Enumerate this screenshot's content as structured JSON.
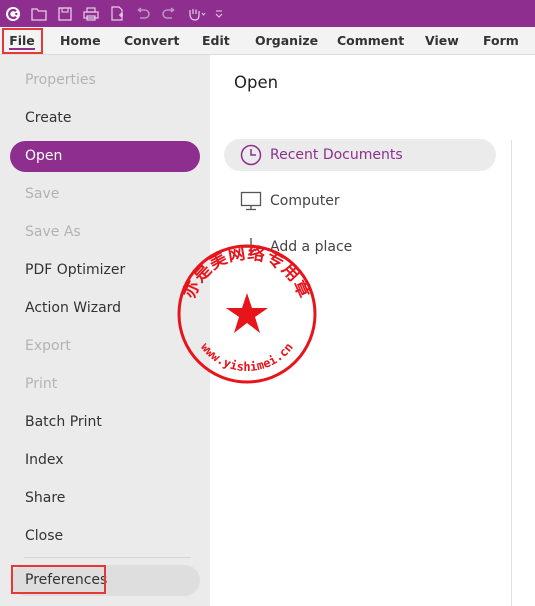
{
  "quick_access": {
    "icons": [
      "app-logo-icon",
      "open-folder-icon",
      "save-icon",
      "print-icon",
      "new-document-icon",
      "undo-icon",
      "redo-icon",
      "hand-tool-icon",
      "customize-dropdown-icon"
    ]
  },
  "tabs": [
    {
      "label": "File"
    },
    {
      "label": "Home"
    },
    {
      "label": "Convert"
    },
    {
      "label": "Edit"
    },
    {
      "label": "Organize"
    },
    {
      "label": "Comment"
    },
    {
      "label": "View"
    },
    {
      "label": "Form"
    }
  ],
  "menu": [
    {
      "label": "Properties",
      "state": "disabled"
    },
    {
      "label": "Create",
      "state": "normal"
    },
    {
      "label": "Open",
      "state": "selected"
    },
    {
      "label": "Save",
      "state": "disabled"
    },
    {
      "label": "Save As",
      "state": "disabled"
    },
    {
      "label": "PDF Optimizer",
      "state": "normal"
    },
    {
      "label": "Action Wizard",
      "state": "normal"
    },
    {
      "label": "Export",
      "state": "disabled"
    },
    {
      "label": "Print",
      "state": "disabled"
    },
    {
      "label": "Batch Print",
      "state": "normal"
    },
    {
      "label": "Index",
      "state": "normal"
    },
    {
      "label": "Share",
      "state": "normal"
    },
    {
      "label": "Close",
      "state": "normal"
    },
    {
      "label": "Preferences",
      "state": "highlighted"
    }
  ],
  "main": {
    "title": "Open",
    "options": [
      {
        "label": "Recent Documents",
        "icon": "clock-icon",
        "selected": true
      },
      {
        "label": "Computer",
        "icon": "monitor-icon",
        "selected": false
      },
      {
        "label": "Add a place",
        "icon": "plus-icon",
        "selected": false
      }
    ]
  },
  "stamp": {
    "text": "亦是美网络专用章",
    "url": "www.yishimei.cn",
    "color": "#e8141b"
  },
  "colors": {
    "accent": "#8e2f8f",
    "highlight_box": "#e53935"
  }
}
